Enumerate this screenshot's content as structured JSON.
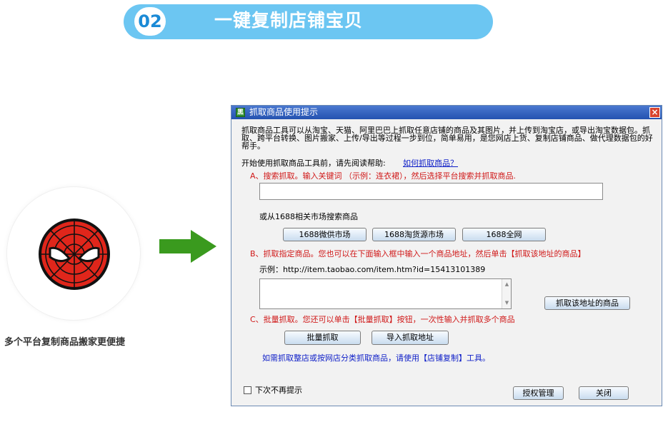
{
  "banner": {
    "number": "02",
    "title": "一键复制店铺宝贝"
  },
  "left": {
    "icon": "spider-mask-icon",
    "caption": "多个平台复制商品搬家更便捷",
    "arrow_icon": "right-arrow-icon"
  },
  "dialog": {
    "title": "抓取商品使用提示",
    "app_icon_text": "黑",
    "close_label": "×",
    "intro": "抓取商品工具可以从淘宝、天猫、阿里巴巴上抓取任意店铺的商品及其图片，并上传到淘宝店，或导出淘宝数据包。抓取、跨平台转换、图片搬家、上传/导出等过程一步到位，简单易用，是您网店上货、复制店铺商品、做代理数据包的好帮手。",
    "help_prefix": "开始使用抓取商品工具前，请先阅读帮助:",
    "help_link": "如何抓取商品？",
    "section_a": "A、搜索抓取。输入关键词 （示例：连衣裙），然后选择平台搜索并抓取商品.",
    "keyword_value": "",
    "market_label": "或从1688相关市场搜索商品",
    "market_buttons": [
      "1688微供市场",
      "1688淘货源市场",
      "1688全网"
    ],
    "section_b": "B、抓取指定商品。您也可以在下面输入框中输入一个商品地址，然后单击【抓取该地址的商品】",
    "example": "示例：http://item.taobao.com/item.htm?id=15413101389",
    "url_value": "",
    "fetch_button": "抓取该地址的商品",
    "section_c": "C、批量抓取。您还可以单击【批量抓取】按钮，一次性输入并抓取多个商品",
    "batch_button": "批量抓取",
    "import_button": "导入抓取地址",
    "shop_hint": "如需抓取整店或按网店分类抓取商品，请使用【店铺复制】工具。",
    "no_remind": "下次不再提示",
    "auth_button": "授权管理",
    "close_button": "关闭"
  },
  "colors": {
    "banner": "#6cc6f2",
    "banner_number": "#1b8ad6",
    "arrow": "#3a9a1e",
    "spider_red": "#e0261b",
    "titlebar": "#2f5fc0"
  }
}
